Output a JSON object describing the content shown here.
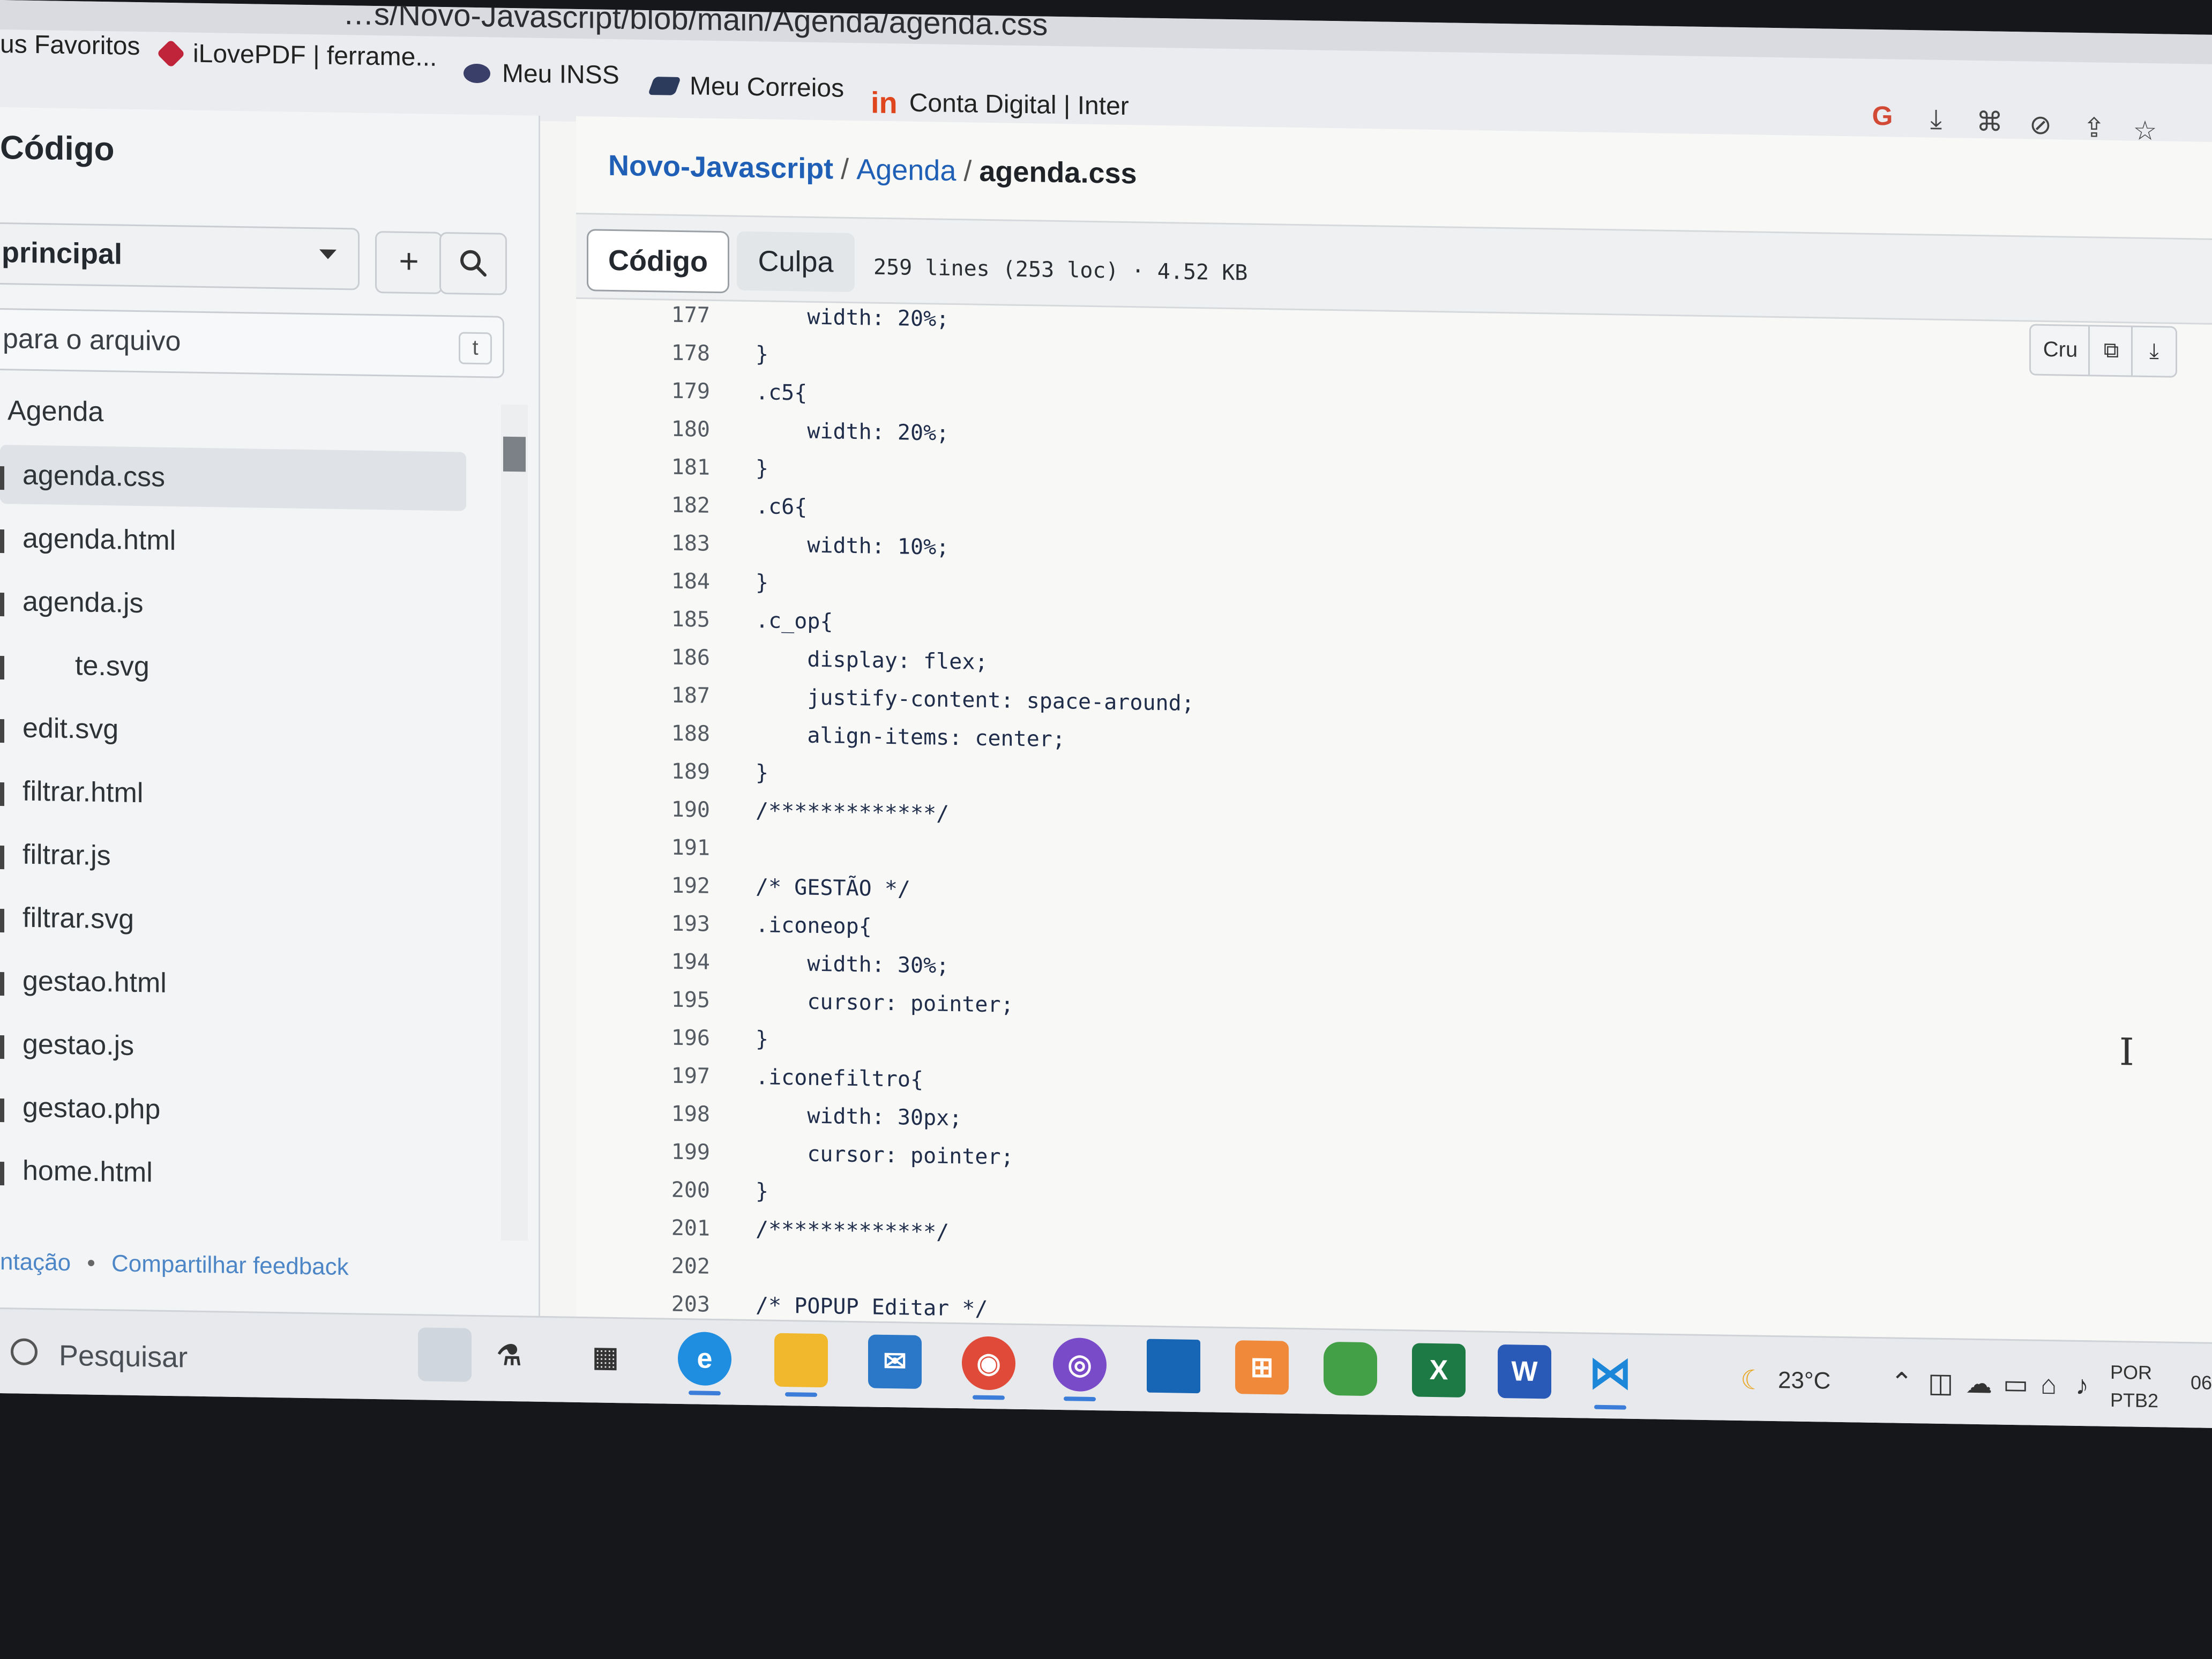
{
  "browser": {
    "url": "…s/Novo-Javascript/blob/main/Agenda/agenda.css",
    "bookmarks": [
      {
        "label": "us Favoritos",
        "icon": "folder-icon"
      },
      {
        "label": "iLovePDF | ferrame...",
        "icon": "ilovepdf-icon"
      },
      {
        "label": "Meu INSS",
        "icon": "inss-icon"
      },
      {
        "label": "Meu Correios",
        "icon": "correios-icon"
      },
      {
        "label": "Conta Digital | Inter",
        "icon": "inter-icon"
      }
    ],
    "toolbar_icons": [
      "google-icon",
      "install-icon",
      "translate-icon",
      "eye-off-icon",
      "share-icon",
      "star-icon"
    ]
  },
  "sidebar": {
    "title": "Código",
    "branch": "principal",
    "add_label": "+",
    "search_placeholder": "para o arquivo",
    "search_shortcut": "t",
    "folder": "Agenda",
    "files": [
      "agenda.css",
      "agenda.html",
      "agenda.js",
      "te.svg",
      "edit.svg",
      "filtrar.html",
      "filtrar.js",
      "filtrar.svg",
      "gestao.html",
      "gestao.js",
      "gestao.php",
      "home.html"
    ],
    "active_file": "agenda.css",
    "footer": {
      "left": "ntação",
      "separator": "•",
      "feedback": "Compartilhar feedback"
    }
  },
  "file_view": {
    "breadcrumb": {
      "repo": "Novo-Javascript",
      "folder": "Agenda",
      "file": "agenda.css",
      "sep": "/"
    },
    "tabs": {
      "code": "Código",
      "blame": "Culpa"
    },
    "file_info": "259 lines (253 loc) · 4.52 KB",
    "raw_label": "Cru",
    "lines": [
      {
        "n": "177",
        "code": "    width: 20%;"
      },
      {
        "n": "178",
        "code": "}"
      },
      {
        "n": "179",
        "code": ".c5{"
      },
      {
        "n": "180",
        "code": "    width: 20%;"
      },
      {
        "n": "181",
        "code": "}"
      },
      {
        "n": "182",
        "code": ".c6{"
      },
      {
        "n": "183",
        "code": "    width: 10%;"
      },
      {
        "n": "184",
        "code": "}"
      },
      {
        "n": "185",
        "code": ".c_op{"
      },
      {
        "n": "186",
        "code": "    display: flex;"
      },
      {
        "n": "187",
        "code": "    justify-content: space-around;"
      },
      {
        "n": "188",
        "code": "    align-items: center;"
      },
      {
        "n": "189",
        "code": "}"
      },
      {
        "n": "190",
        "code": "/*************/"
      },
      {
        "n": "191",
        "code": ""
      },
      {
        "n": "192",
        "code": "/* GESTÃO */"
      },
      {
        "n": "193",
        "code": ".iconeop{"
      },
      {
        "n": "194",
        "code": "    width: 30%;"
      },
      {
        "n": "195",
        "code": "    cursor: pointer;"
      },
      {
        "n": "196",
        "code": "}"
      },
      {
        "n": "197",
        "code": ".iconefiltro{"
      },
      {
        "n": "198",
        "code": "    width: 30px;"
      },
      {
        "n": "199",
        "code": "    cursor: pointer;"
      },
      {
        "n": "200",
        "code": "}"
      },
      {
        "n": "201",
        "code": "/*************/"
      },
      {
        "n": "202",
        "code": ""
      },
      {
        "n": "203",
        "code": "/* POPUP Editar */"
      }
    ]
  },
  "taskbar": {
    "search_placeholder": "Pesquisar",
    "apps": [
      "task-view-icon",
      "edge-icon",
      "file-explorer-icon",
      "mail-icon",
      "chrome-icon",
      "github-desktop-icon",
      "app-blue-icon",
      "xampp-icon",
      "app-green-icon",
      "excel-icon",
      "word-icon",
      "vscode-icon"
    ],
    "weather": "23°C",
    "lang_top": "POR",
    "lang_bottom": "PTB2",
    "clock_partial": "06"
  },
  "colors": {
    "link": "#1f5fb5",
    "active_file_bg": "#dfe2e6",
    "code_text": "#1f2d4a",
    "accent_ul": "#3b7dd8"
  }
}
